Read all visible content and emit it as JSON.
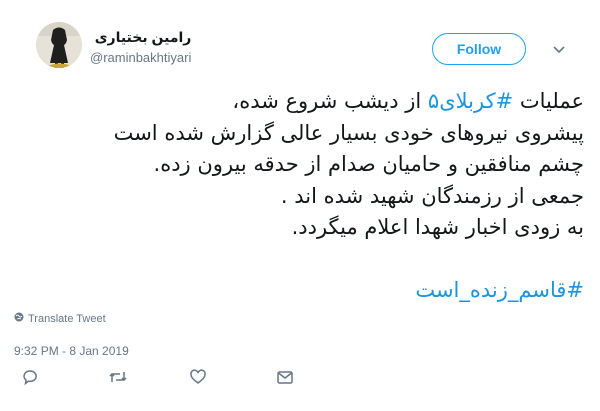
{
  "user": {
    "display_name": "رامین بختیاری",
    "handle": "@raminbakhtiyari"
  },
  "follow_label": "Follow",
  "tweet": {
    "line1_pre": "عملیات ",
    "line1_hashtag": "#کربلای۵",
    "line1_post": " از دیشب شروع شده،",
    "line2": "پیشروی نیروهای خودی بسیار عالی گزارش شده است",
    "line3": "چشم منافقین و حامیان صدام از حدقه بیرون زده.",
    "line4": "جمعی از رزمندگان شهید شده اند .",
    "line5": "به زودی اخبار شهدا اعلام میگردد.",
    "hashtag2": "#قاسم_زنده_است"
  },
  "translate_label": "Translate Tweet",
  "timestamp": "9:32 PM - 8 Jan 2019",
  "colors": {
    "accent": "#1da1f2",
    "link": "#1b95e0",
    "muted": "#657786"
  },
  "icons": [
    "globe-icon",
    "chevron-down-icon",
    "reply-icon",
    "retweet-icon",
    "like-icon",
    "message-icon"
  ]
}
